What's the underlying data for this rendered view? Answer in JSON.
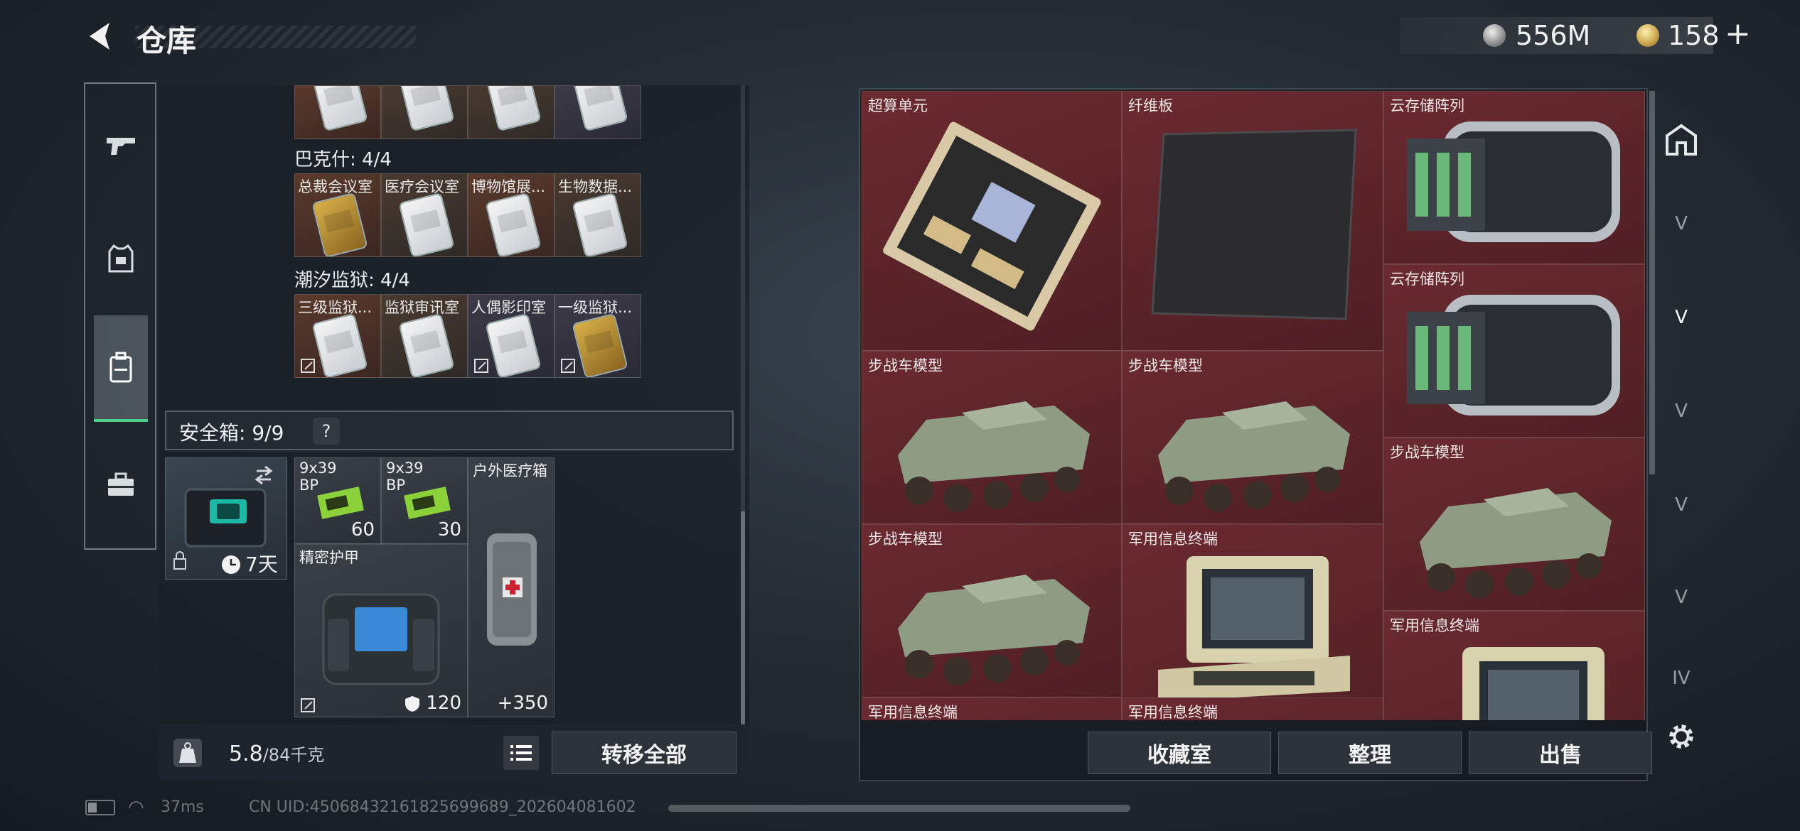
{
  "header": {
    "title": "仓库",
    "currencies": [
      {
        "icon": "silver-coin-icon",
        "value": "556M"
      },
      {
        "icon": "gold-coin-icon",
        "value": "158"
      }
    ],
    "add_label": "+"
  },
  "left_rail": {
    "items": [
      {
        "icon": "pistol-icon"
      },
      {
        "icon": "armor-vest-icon"
      },
      {
        "icon": "backpack-icon",
        "active": true
      },
      {
        "icon": "toolbox-icon"
      }
    ]
  },
  "inventory": {
    "top_row": [
      {
        "name": "",
        "color": "r1"
      },
      {
        "name": "",
        "color": "r2"
      },
      {
        "name": "",
        "color": "r2"
      },
      {
        "name": "",
        "color": "r3"
      }
    ],
    "groups": [
      {
        "label": "巴克什: 4/4",
        "cards": [
          {
            "name": "总裁会议室",
            "card": "gold",
            "locked": false,
            "color": "r1"
          },
          {
            "name": "医疗会议室",
            "card": "white",
            "locked": false,
            "color": "r2"
          },
          {
            "name": "博物馆展...",
            "card": "white",
            "locked": false,
            "color": "r1"
          },
          {
            "name": "生物数据...",
            "card": "white",
            "locked": false,
            "color": "r2"
          }
        ]
      },
      {
        "label": "潮汐监狱: 4/4",
        "cards": [
          {
            "name": "三级监狱...",
            "card": "white",
            "locked": true,
            "color": "r1"
          },
          {
            "name": "监狱审讯室",
            "card": "white",
            "locked": false,
            "color": "r2"
          },
          {
            "name": "人偶影印室",
            "card": "white",
            "locked": true,
            "color": "r3"
          },
          {
            "name": "一级监狱...",
            "card": "gold",
            "locked": true,
            "color": "r3"
          }
        ]
      }
    ],
    "safebox": {
      "label": "安全箱: 9/9",
      "help": "?",
      "duration": "7天",
      "items": [
        {
          "name": "9x39",
          "sub": "BP",
          "qty": "60"
        },
        {
          "name": "9x39",
          "sub": "BP",
          "qty": "30"
        },
        {
          "name": "户外医疗箱",
          "qty": "+350"
        },
        {
          "name": "精密护甲",
          "qty": "120"
        }
      ]
    },
    "weight": {
      "current": "5.8",
      "max": "/84",
      "unit": "千克"
    },
    "transfer_all": "转移全部"
  },
  "storage": {
    "cells": [
      {
        "name": "超算单元"
      },
      {
        "name": "纤维板"
      },
      {
        "name": "云存储阵列"
      },
      {
        "name": "云存储阵列"
      },
      {
        "name": "步战车模型"
      },
      {
        "name": "步战车模型"
      },
      {
        "name": "步战车模型"
      },
      {
        "name": "步战车模型"
      },
      {
        "name": "军用信息终端"
      },
      {
        "name": "军用信息终端"
      },
      {
        "name": "军用信息终端"
      },
      {
        "name": "军用信息终端"
      }
    ],
    "buttons": {
      "collection": "收藏室",
      "organize": "整理",
      "sell": "出售"
    }
  },
  "right_rail": {
    "items": [
      {
        "icon": "home-icon"
      },
      {
        "icon": "tier-v-icon",
        "label": "V"
      },
      {
        "icon": "tier-v-icon",
        "label": "V",
        "active": true
      },
      {
        "icon": "tier-v-icon",
        "label": "V"
      },
      {
        "icon": "tier-v-icon",
        "label": "V"
      },
      {
        "icon": "tier-v-icon",
        "label": "V"
      },
      {
        "icon": "tier-iv-icon",
        "label": "IV"
      },
      {
        "icon": "settings-gear-icon"
      }
    ]
  },
  "status_bar": {
    "ping": "37ms",
    "uid": "CN UID:450684321618256996​89_202604081602"
  },
  "colors": {
    "accent_green": "#4dd08a",
    "storage_red": "#6a2a30",
    "panel_dark": "#181e25"
  }
}
